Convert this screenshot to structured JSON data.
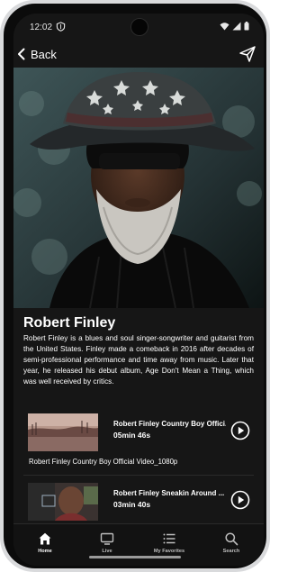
{
  "status_bar": {
    "time": "12:02"
  },
  "topbar": {
    "back_label": "Back"
  },
  "artist": {
    "name": "Robert Finley",
    "bio": "Robert Finley is a blues and soul singer-songwriter and guitarist from the United States. Finley made a comeback in 2016 after decades of semi-professional performance and time away from music. Later that year, he released his debut album, Age Don't Mean a Thing, which was well received by critics."
  },
  "videos": [
    {
      "title": "Robert Finley Country Boy Offici...",
      "duration": "05min 46s",
      "caption": "Robert Finley Country Boy Official Video_1080p"
    },
    {
      "title": "Robert Finley Sneakin Around ...",
      "duration": "03min 40s"
    }
  ],
  "bottom_nav": [
    {
      "label": "Home",
      "icon": "home-icon",
      "active": true
    },
    {
      "label": "Live",
      "icon": "tv-icon",
      "active": false
    },
    {
      "label": "My Favorites",
      "icon": "list-icon",
      "active": false
    },
    {
      "label": "Search",
      "icon": "search-icon",
      "active": false
    }
  ],
  "colors": {
    "background": "#161616",
    "text": "#ffffff",
    "nav_bg": "#121212"
  }
}
